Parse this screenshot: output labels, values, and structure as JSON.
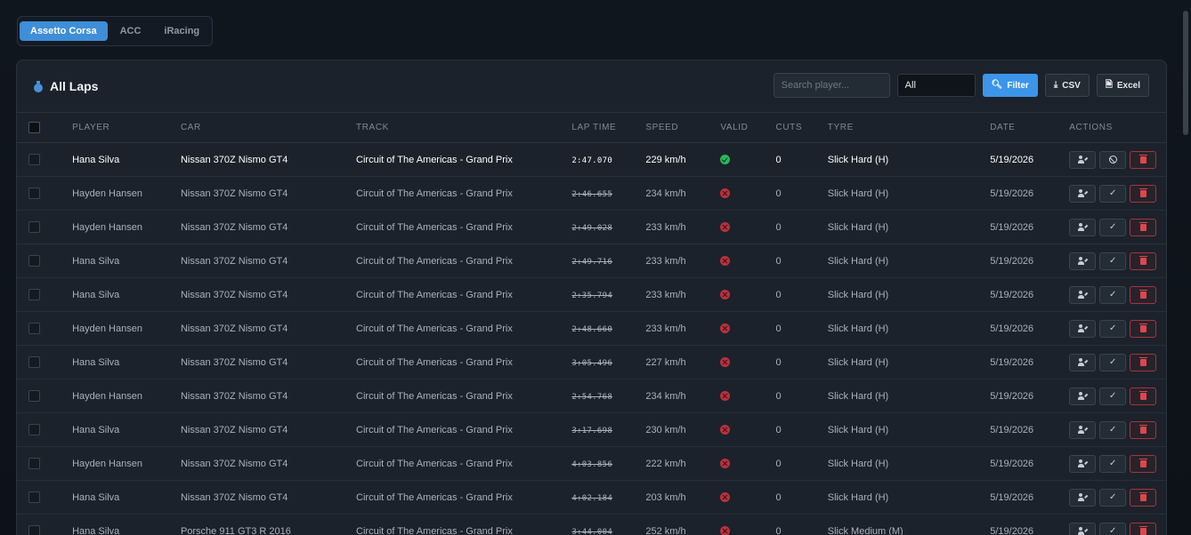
{
  "game_tabs": [
    {
      "label": "Assetto Corsa",
      "active": true
    },
    {
      "label": "ACC",
      "active": false
    },
    {
      "label": "iRacing",
      "active": false
    }
  ],
  "card": {
    "title": "All Laps",
    "title_icon": "stopwatch-icon"
  },
  "toolbar": {
    "search_placeholder": "Search player...",
    "search_value": "",
    "select_value": "All",
    "filter_label": "Filter",
    "csv_label": "CSV",
    "excel_label": "Excel"
  },
  "table": {
    "columns": [
      "PLAYER",
      "CAR",
      "TRACK",
      "LAP TIME",
      "SPEED",
      "VALID",
      "CUTS",
      "TYRE",
      "DATE",
      "ACTIONS"
    ],
    "rows": [
      {
        "player": "Hana Silva",
        "car": "Nissan 370Z Nismo GT4",
        "track": "Circuit of The Americas - Grand Prix",
        "lap_time": "2:47.070",
        "speed": "229 km/h",
        "valid": true,
        "cuts": "0",
        "tyre": "Slick Hard (H)",
        "date": "5/19/2026"
      },
      {
        "player": "Hayden Hansen",
        "car": "Nissan 370Z Nismo GT4",
        "track": "Circuit of The Americas - Grand Prix",
        "lap_time": "2:46.655",
        "speed": "234 km/h",
        "valid": false,
        "cuts": "0",
        "tyre": "Slick Hard (H)",
        "date": "5/19/2026"
      },
      {
        "player": "Hayden Hansen",
        "car": "Nissan 370Z Nismo GT4",
        "track": "Circuit of The Americas - Grand Prix",
        "lap_time": "2:49.028",
        "speed": "233 km/h",
        "valid": false,
        "cuts": "0",
        "tyre": "Slick Hard (H)",
        "date": "5/19/2026"
      },
      {
        "player": "Hana Silva",
        "car": "Nissan 370Z Nismo GT4",
        "track": "Circuit of The Americas - Grand Prix",
        "lap_time": "2:49.716",
        "speed": "233 km/h",
        "valid": false,
        "cuts": "0",
        "tyre": "Slick Hard (H)",
        "date": "5/19/2026"
      },
      {
        "player": "Hana Silva",
        "car": "Nissan 370Z Nismo GT4",
        "track": "Circuit of The Americas - Grand Prix",
        "lap_time": "2:35.794",
        "speed": "233 km/h",
        "valid": false,
        "cuts": "0",
        "tyre": "Slick Hard (H)",
        "date": "5/19/2026"
      },
      {
        "player": "Hayden Hansen",
        "car": "Nissan 370Z Nismo GT4",
        "track": "Circuit of The Americas - Grand Prix",
        "lap_time": "2:48.660",
        "speed": "233 km/h",
        "valid": false,
        "cuts": "0",
        "tyre": "Slick Hard (H)",
        "date": "5/19/2026"
      },
      {
        "player": "Hana Silva",
        "car": "Nissan 370Z Nismo GT4",
        "track": "Circuit of The Americas - Grand Prix",
        "lap_time": "3:05.496",
        "speed": "227 km/h",
        "valid": false,
        "cuts": "0",
        "tyre": "Slick Hard (H)",
        "date": "5/19/2026"
      },
      {
        "player": "Hayden Hansen",
        "car": "Nissan 370Z Nismo GT4",
        "track": "Circuit of The Americas - Grand Prix",
        "lap_time": "2:54.768",
        "speed": "234 km/h",
        "valid": false,
        "cuts": "0",
        "tyre": "Slick Hard (H)",
        "date": "5/19/2026"
      },
      {
        "player": "Hana Silva",
        "car": "Nissan 370Z Nismo GT4",
        "track": "Circuit of The Americas - Grand Prix",
        "lap_time": "3:17.698",
        "speed": "230 km/h",
        "valid": false,
        "cuts": "0",
        "tyre": "Slick Hard (H)",
        "date": "5/19/2026"
      },
      {
        "player": "Hayden Hansen",
        "car": "Nissan 370Z Nismo GT4",
        "track": "Circuit of The Americas - Grand Prix",
        "lap_time": "4:03.856",
        "speed": "222 km/h",
        "valid": false,
        "cuts": "0",
        "tyre": "Slick Hard (H)",
        "date": "5/19/2026"
      },
      {
        "player": "Hana Silva",
        "car": "Nissan 370Z Nismo GT4",
        "track": "Circuit of The Americas - Grand Prix",
        "lap_time": "4:02.184",
        "speed": "203 km/h",
        "valid": false,
        "cuts": "0",
        "tyre": "Slick Hard (H)",
        "date": "5/19/2026"
      },
      {
        "player": "Hana Silva",
        "car": "Porsche 911 GT3 R 2016",
        "track": "Circuit of The Americas - Grand Prix",
        "lap_time": "3:44.004",
        "speed": "252 km/h",
        "valid": false,
        "cuts": "0",
        "tyre": "Slick Medium (M)",
        "date": "5/19/2026"
      }
    ]
  },
  "colors": {
    "accent": "#3c95e8",
    "valid": "#28b85a",
    "invalid": "#b8323d",
    "danger": "#e0454f"
  }
}
